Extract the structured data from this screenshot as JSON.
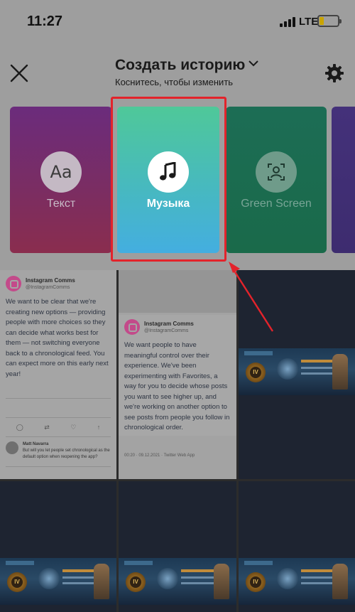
{
  "status_bar": {
    "time": "11:27",
    "network": "LTE",
    "battery_level": 0.25,
    "battery_color": "#c9a400"
  },
  "header": {
    "title": "Создать историю",
    "subtitle": "Коснитесь, чтобы изменить",
    "close_icon": "close-icon",
    "settings_icon": "gear-icon",
    "dropdown_icon": "chevron-down-icon"
  },
  "modes": [
    {
      "label": "Текст",
      "icon": "Aa"
    },
    {
      "label": "Музыка",
      "icon": "music-note-icon"
    },
    {
      "label": "Green Screen",
      "icon": "green-screen-icon"
    }
  ],
  "highlight_color": "#e3232b",
  "gallery": {
    "tweet1": {
      "name": "Instagram Comms",
      "handle": "@InstagramComms",
      "body": "We want to be clear that we're creating new options — providing people with more choices so they can decide what works best for them — not switching everyone back to a chronological feed. You can expect more on this early next year!"
    },
    "tweet2": {
      "name": "Instagram Comms",
      "handle": "@InstagramComms",
      "body": "We want people to have meaningful control over their experience. We've been experimenting with Favorites, a way for you to decide whose posts you want to see higher up, and we're working on another option to see posts from people you follow in chronological order.",
      "meta": "00:20 · 09.12.2021 · Twitter Web App"
    },
    "reply": {
      "name": "Matt Navarra",
      "text": "But will you let people set chronological as the default option when reopening the app?"
    },
    "game_tile_badge": "IV"
  }
}
